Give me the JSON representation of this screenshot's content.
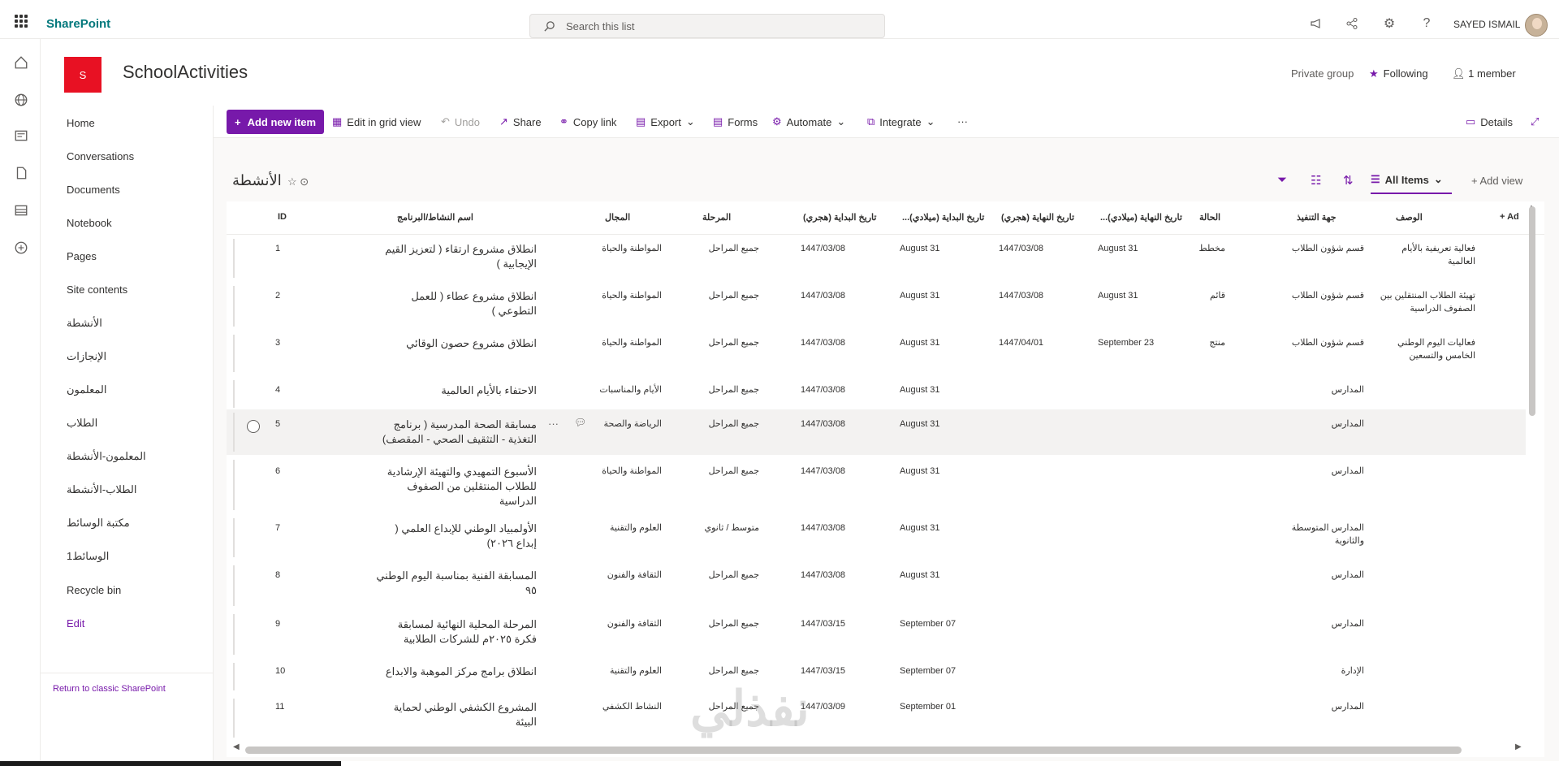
{
  "suite": {
    "brand": "SharePoint",
    "search_placeholder": "Search this list",
    "user_name": "SAYED ISMAIL"
  },
  "site": {
    "logo_letter": "S",
    "title": "SchoolActivities",
    "private_group": "Private group",
    "following": "Following",
    "members": "1 member"
  },
  "nav": {
    "items": [
      "Home",
      "Conversations",
      "Documents",
      "Notebook",
      "Pages",
      "Site contents",
      "الأنشطة",
      "الإنجازات",
      "المعلمون",
      "الطلاب",
      "المعلمون-الأنشطة",
      "الطلاب-الأنشطة",
      "مكتبة الوسائط",
      "الوسائط1",
      "Recycle bin"
    ],
    "edit": "Edit",
    "classic": "Return to classic SharePoint"
  },
  "toolbar": {
    "add": "Add new item",
    "edit_grid": "Edit in grid view",
    "undo": "Undo",
    "share": "Share",
    "copy_link": "Copy link",
    "export": "Export",
    "forms": "Forms",
    "automate": "Automate",
    "integrate": "Integrate",
    "more": "···",
    "details": "Details"
  },
  "list": {
    "title": "الأنشطة",
    "view": "All Items",
    "add_view": "Add view",
    "columns": {
      "id": "ID",
      "name": "اسم النشاط/البرنامج",
      "field": "المجال",
      "stage": "المرحلة",
      "start_hijri": "تاريخ البداية (هجري)",
      "start_greg": "...تاريخ البداية (ميلادي)",
      "end_hijri": "تاريخ النهاية (هجري)",
      "end_greg": "...تاريخ النهاية (ميلادي)",
      "status": "الحالة",
      "exec": "جهة التنفيذ",
      "desc": "الوصف",
      "add": "+ Ad"
    },
    "rows": [
      {
        "id": "1",
        "name": "انطلاق مشروع ارتقاء ( لتعزيز القيم الإيجابية )",
        "field": "المواطنة والحياة",
        "stage": "جميع المراحل",
        "start_hijri": "1447/03/08",
        "start_greg": "August 31",
        "end_hijri": "1447/03/08",
        "end_greg": "August 31",
        "status": "مخطط",
        "exec": "قسم شؤون الطلاب",
        "desc": "فعالية تعريفية بالأيام العالمية"
      },
      {
        "id": "2",
        "name": "انطلاق مشروع عطاء ( للعمل التطوعي )",
        "field": "المواطنة والحياة",
        "stage": "جميع المراحل",
        "start_hijri": "1447/03/08",
        "start_greg": "August 31",
        "end_hijri": "1447/03/08",
        "end_greg": "August 31",
        "status": "قائم",
        "exec": "قسم شؤون الطلاب",
        "desc": "تهيئة الطلاب المنتقلين بين الصفوف الدراسية"
      },
      {
        "id": "3",
        "name": "انطلاق مشروع حصون الوقائي",
        "field": "المواطنة والحياة",
        "stage": "جميع المراحل",
        "start_hijri": "1447/03/08",
        "start_greg": "August 31",
        "end_hijri": "1447/04/01",
        "end_greg": "September 23",
        "status": "منتج",
        "exec": "قسم شؤون الطلاب",
        "desc": "فعاليات اليوم الوطني الخامس والتسعين"
      },
      {
        "id": "4",
        "name": "الاحتفاء بالأيام العالمية",
        "field": "الأيام والمناسبات",
        "stage": "جميع المراحل",
        "start_hijri": "1447/03/08",
        "start_greg": "August 31",
        "end_hijri": "",
        "end_greg": "",
        "status": "",
        "exec": "المدارس",
        "desc": ""
      },
      {
        "id": "5",
        "name": "مسابقة الصحة المدرسية ( برنامج التغذية - التثقيف الصحي - المقصف)",
        "field": "الرياضة والصحة",
        "stage": "جميع المراحل",
        "start_hijri": "1447/03/08",
        "start_greg": "August 31",
        "end_hijri": "",
        "end_greg": "",
        "status": "",
        "exec": "المدارس",
        "desc": ""
      },
      {
        "id": "6",
        "name": "الأسبوع التمهيدي والتهيئة الإرشادية للطلاب المنتقلين من الصفوف الدراسية",
        "field": "المواطنة والحياة",
        "stage": "جميع المراحل",
        "start_hijri": "1447/03/08",
        "start_greg": "August 31",
        "end_hijri": "",
        "end_greg": "",
        "status": "",
        "exec": "المدارس",
        "desc": ""
      },
      {
        "id": "7",
        "name": "الأولمبياد الوطني للإبداع العلمي ( إبداع ٢٠٢٦)",
        "field": "العلوم والتقنية",
        "stage": "متوسط / ثانوي",
        "start_hijri": "1447/03/08",
        "start_greg": "August 31",
        "end_hijri": "",
        "end_greg": "",
        "status": "",
        "exec": "المدارس المتوسطة والثانوية",
        "desc": ""
      },
      {
        "id": "8",
        "name": "المسابقة الفنية بمناسبة اليوم الوطني ٩٥",
        "field": "الثقافة والفنون",
        "stage": "جميع المراحل",
        "start_hijri": "1447/03/08",
        "start_greg": "August 31",
        "end_hijri": "",
        "end_greg": "",
        "status": "",
        "exec": "المدارس",
        "desc": ""
      },
      {
        "id": "9",
        "name": "المرحلة المحلية النهائية لمسابقة فكرة ٢٠٢٥م للشركات الطلابية",
        "field": "الثقافة والفنون",
        "stage": "جميع المراحل",
        "start_hijri": "1447/03/15",
        "start_greg": "September 07",
        "end_hijri": "",
        "end_greg": "",
        "status": "",
        "exec": "المدارس",
        "desc": ""
      },
      {
        "id": "10",
        "name": "انطلاق برامج مركز الموهبة والابداع",
        "field": "العلوم والتقنية",
        "stage": "جميع المراحل",
        "start_hijri": "1447/03/15",
        "start_greg": "September 07",
        "end_hijri": "",
        "end_greg": "",
        "status": "",
        "exec": "الإدارة",
        "desc": ""
      },
      {
        "id": "11",
        "name": "المشروع الكشفي الوطني لحماية البيئة",
        "field": "النشاط الكشفي",
        "stage": "جميع المراحل",
        "start_hijri": "1447/03/09",
        "start_greg": "September 01",
        "end_hijri": "",
        "end_greg": "",
        "status": "",
        "exec": "المدارس",
        "desc": ""
      }
    ]
  },
  "watermark": "نفذلي",
  "colors": {
    "accent": "#7719aa",
    "logo": "#e81123",
    "brand": "#03787c"
  }
}
